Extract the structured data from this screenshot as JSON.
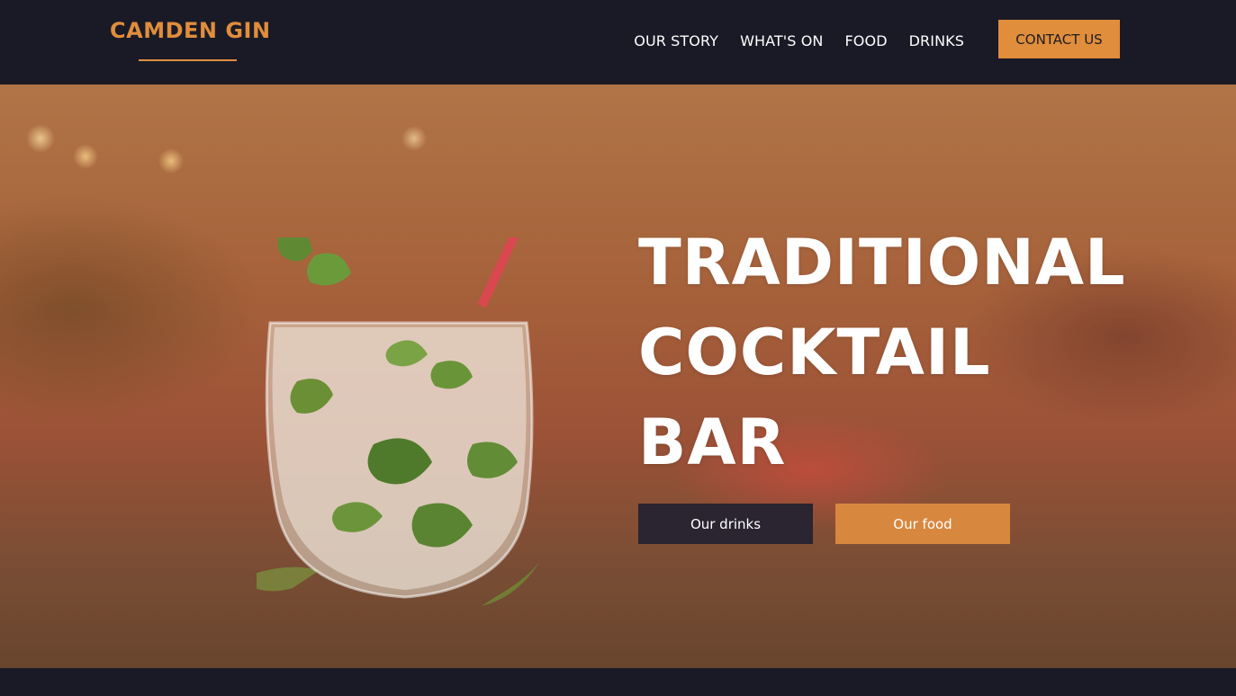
{
  "header": {
    "logo": "CAMDEN GIN",
    "nav": [
      "OUR STORY",
      "WHAT'S ON",
      "FOOD",
      "DRINKS"
    ],
    "contact_label": "CONTACT US"
  },
  "hero": {
    "title_lines": [
      "TRADITIONAL",
      "COCKTAIL",
      "BAR"
    ],
    "buttons": {
      "drinks": "Our drinks",
      "food": "Our food"
    }
  },
  "colors": {
    "accent": "#e08d3c",
    "navy": "#191a26",
    "dark_button": "#2a2530"
  },
  "images": {
    "hero": "mojito-cocktail-photo"
  }
}
